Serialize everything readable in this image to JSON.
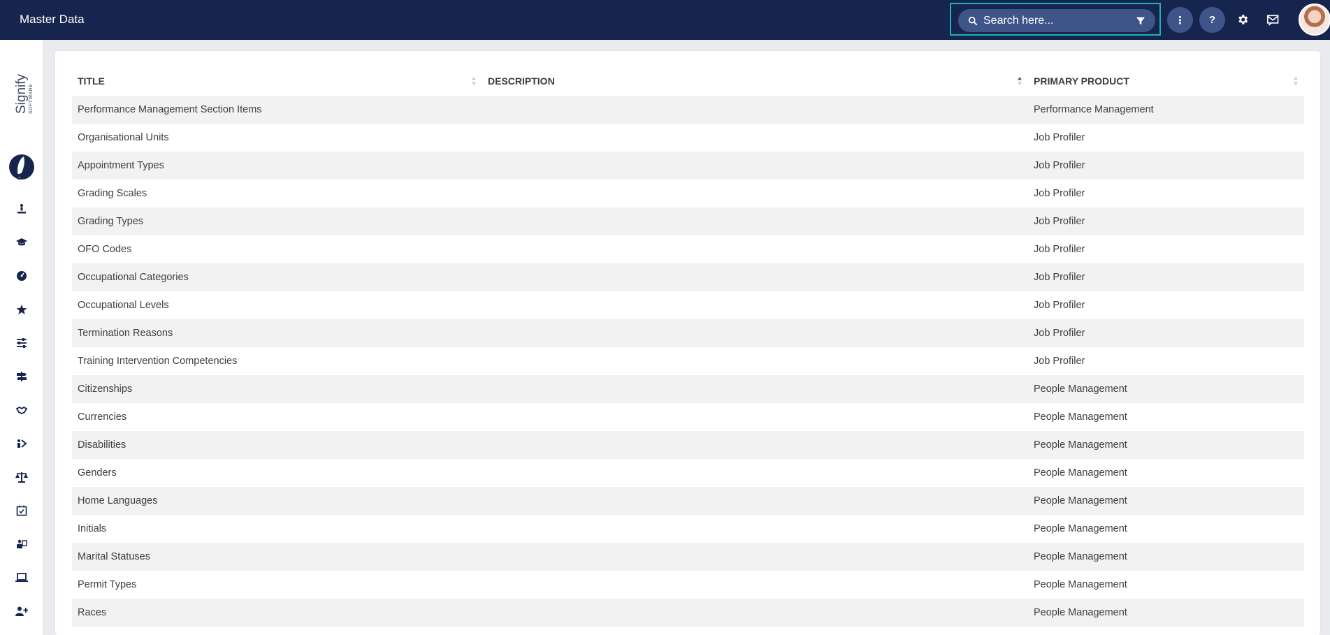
{
  "header": {
    "title": "Master Data",
    "search_placeholder": "Search here...",
    "more_label": "⋮",
    "help_label": "?"
  },
  "sidebar": {
    "logo_text": "Signify",
    "logo_subtext": "SOFTWARE",
    "items": [
      {
        "icon": "megaphone-icon"
      },
      {
        "icon": "person-pedestal-icon"
      },
      {
        "icon": "graduation-cap-icon"
      },
      {
        "icon": "gauge-icon"
      },
      {
        "icon": "star-icon"
      },
      {
        "icon": "sliders-icon"
      },
      {
        "icon": "signpost-icon"
      },
      {
        "icon": "handshake-icon"
      },
      {
        "icon": "people-arrows-icon"
      },
      {
        "icon": "balance-scale-icon"
      },
      {
        "icon": "calendar-check-icon"
      },
      {
        "icon": "person-board-icon"
      },
      {
        "icon": "laptop-icon"
      },
      {
        "icon": "user-plus-icon"
      }
    ]
  },
  "table": {
    "columns": [
      {
        "label": "TITLE"
      },
      {
        "label": "DESCRIPTION"
      },
      {
        "label": "PRIMARY PRODUCT"
      }
    ],
    "rows": [
      {
        "title": "Performance Management Section Items",
        "description": "",
        "product": "Performance Management"
      },
      {
        "title": "Organisational Units",
        "description": "",
        "product": "Job Profiler"
      },
      {
        "title": "Appointment Types",
        "description": "",
        "product": "Job Profiler"
      },
      {
        "title": "Grading Scales",
        "description": "",
        "product": "Job Profiler"
      },
      {
        "title": "Grading Types",
        "description": "",
        "product": "Job Profiler"
      },
      {
        "title": "OFO Codes",
        "description": "",
        "product": "Job Profiler"
      },
      {
        "title": "Occupational Categories",
        "description": "",
        "product": "Job Profiler"
      },
      {
        "title": "Occupational Levels",
        "description": "",
        "product": "Job Profiler"
      },
      {
        "title": "Termination Reasons",
        "description": "",
        "product": "Job Profiler"
      },
      {
        "title": "Training Intervention Competencies",
        "description": "",
        "product": "Job Profiler"
      },
      {
        "title": "Citizenships",
        "description": "",
        "product": "People Management"
      },
      {
        "title": "Currencies",
        "description": "",
        "product": "People Management"
      },
      {
        "title": "Disabilities",
        "description": "",
        "product": "People Management"
      },
      {
        "title": "Genders",
        "description": "",
        "product": "People Management"
      },
      {
        "title": "Home Languages",
        "description": "",
        "product": "People Management"
      },
      {
        "title": "Initials",
        "description": "",
        "product": "People Management"
      },
      {
        "title": "Marital Statuses",
        "description": "",
        "product": "People Management"
      },
      {
        "title": "Permit Types",
        "description": "",
        "product": "People Management"
      },
      {
        "title": "Races",
        "description": "",
        "product": "People Management"
      }
    ]
  },
  "colors": {
    "header_bg": "#16254d",
    "search_bg": "#3f5488",
    "focus_border": "#1fb1b5",
    "row_stripe": "#f2f2f2"
  }
}
